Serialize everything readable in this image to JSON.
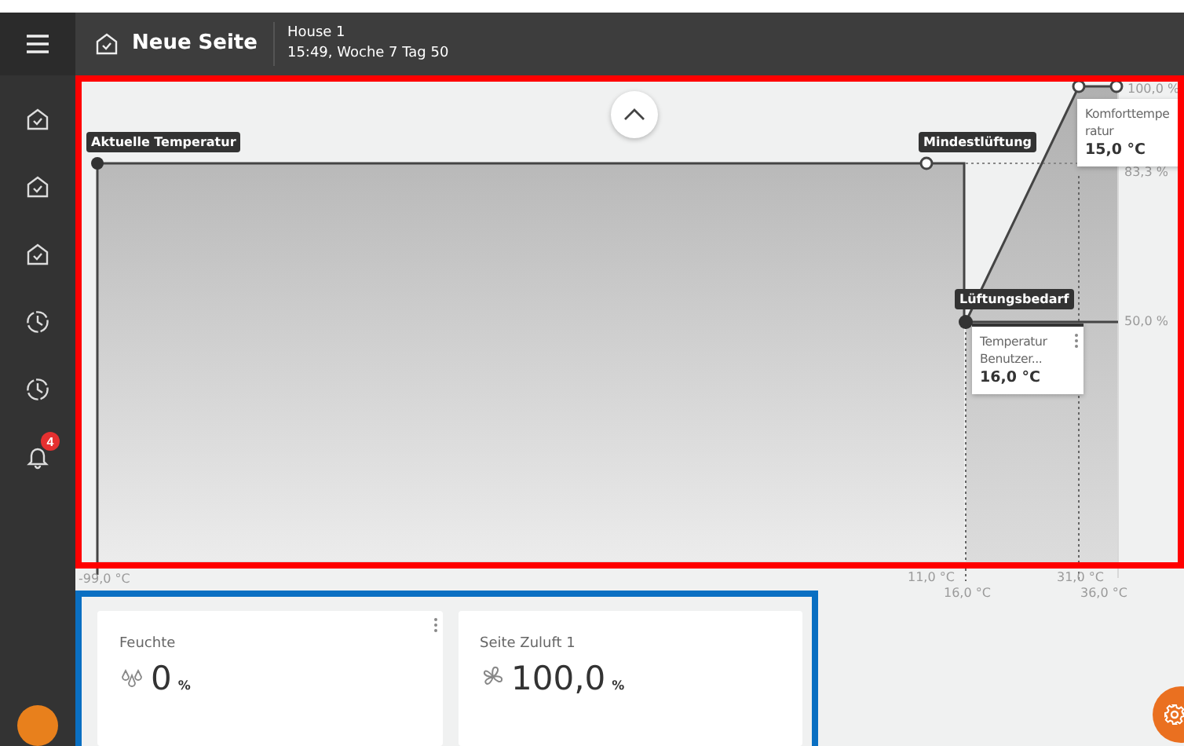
{
  "header": {
    "title": "Neue Seite",
    "location": "House 1",
    "datetime": "15:49, Woche 7 Tag 50"
  },
  "sidebar": {
    "items": [
      {
        "kind": "page"
      },
      {
        "kind": "page"
      },
      {
        "kind": "page"
      },
      {
        "kind": "schedule"
      },
      {
        "kind": "schedule"
      },
      {
        "kind": "alarm",
        "badge": "4"
      }
    ]
  },
  "chart": {
    "markers": [
      {
        "label": "Aktuelle Temperatur"
      },
      {
        "label": "Mindestlüftung"
      },
      {
        "label": "Lüftungsbedarf"
      }
    ],
    "cards": [
      {
        "title_lines": [
          "Komforttempe",
          "ratur"
        ],
        "value": "15,0 °C",
        "menu": false
      },
      {
        "title_lines": [
          "Temperatur",
          "Benutzer..."
        ],
        "value": "16,0 °C",
        "menu": true
      }
    ],
    "y_labels": [
      "100,0 %",
      "83,3 %",
      "50,0 %"
    ],
    "x_labels": [
      "-99,0 °C",
      "11,0 °C",
      "16,0 °C",
      "31,0 °C",
      "36,0 °C"
    ]
  },
  "tiles": [
    {
      "title": "Feuchte",
      "kind": "humidity",
      "value": "0",
      "unit": "%",
      "menu": true
    },
    {
      "title": "Seite Zuluft 1",
      "kind": "fan",
      "value": "100,0",
      "unit": "%",
      "menu": false
    }
  ]
}
